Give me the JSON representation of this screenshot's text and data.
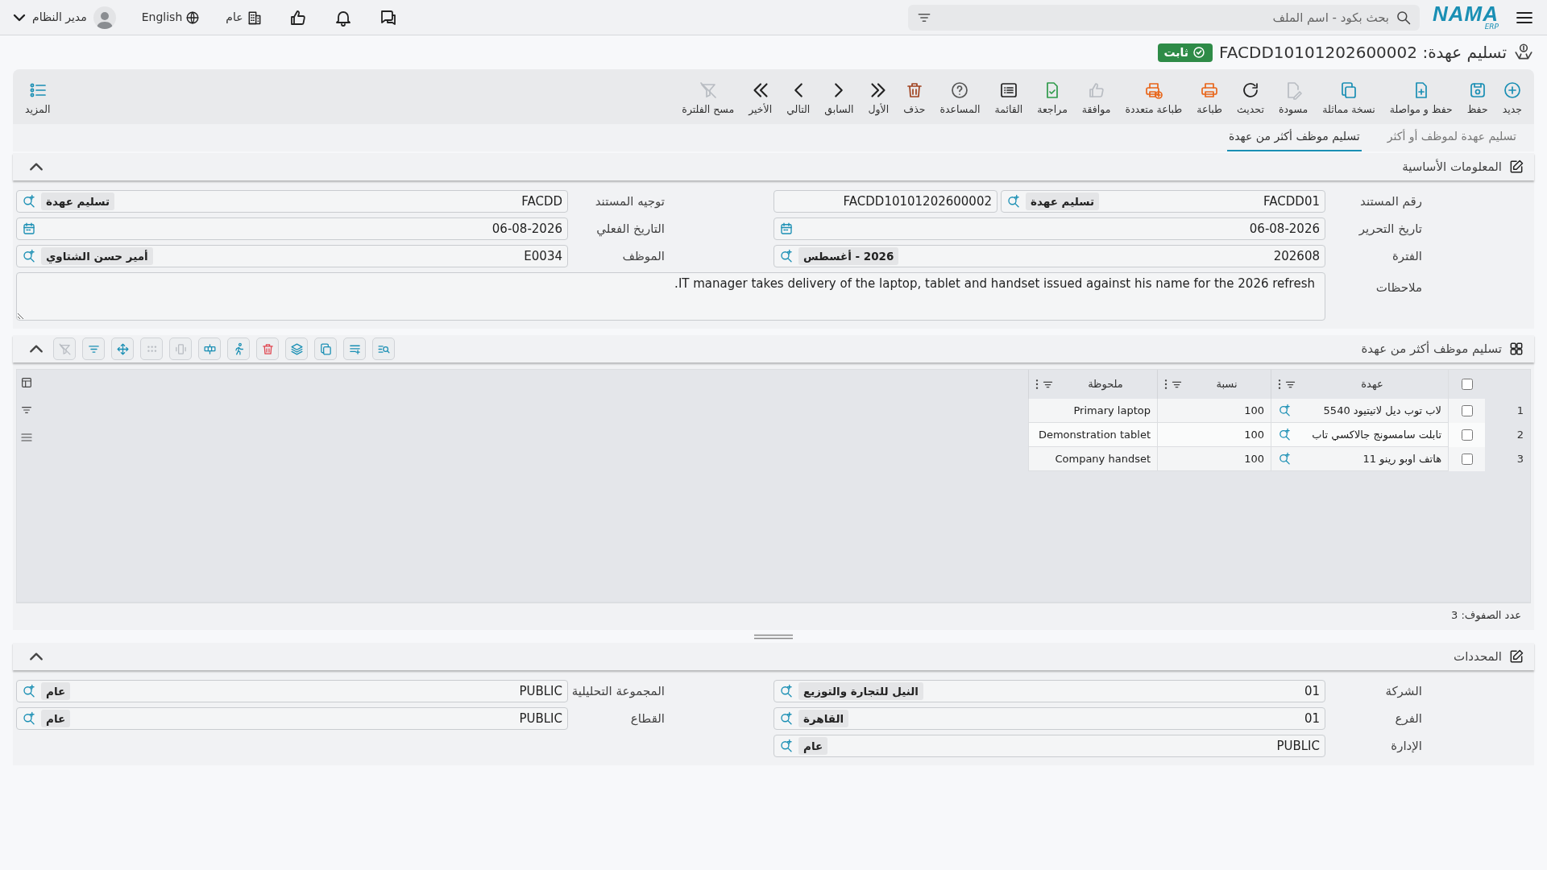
{
  "topbar": {
    "logo": "NAMA",
    "logo_sub": "ERP",
    "search_placeholder": "بحث بكود - اسم الملف",
    "scope": "عام",
    "language": "English",
    "user": "مدير النظام"
  },
  "header": {
    "title": "تسليم عهدة: FACDD10101202600002",
    "status": "ثابت"
  },
  "toolbar": [
    {
      "kind": "new",
      "label": "جديد",
      "disabled": false
    },
    {
      "kind": "save",
      "label": "حفظ",
      "disabled": false
    },
    {
      "kind": "save_continue",
      "label": "حفظ و مواصلة",
      "disabled": false
    },
    {
      "kind": "duplicate",
      "label": "نسخة مماثلة",
      "disabled": false
    },
    {
      "kind": "draft",
      "label": "مسودة",
      "disabled": true
    },
    {
      "kind": "refresh",
      "label": "تحديث",
      "disabled": false
    },
    {
      "kind": "print",
      "label": "طباعة",
      "disabled": false
    },
    {
      "kind": "multi_print",
      "label": "طباعة متعددة",
      "disabled": false
    },
    {
      "kind": "approve",
      "label": "موافقة",
      "disabled": true
    },
    {
      "kind": "review",
      "label": "مراجعة",
      "disabled": false
    },
    {
      "kind": "list",
      "label": "القائمة",
      "disabled": false
    },
    {
      "kind": "help",
      "label": "المساعدة",
      "disabled": false
    },
    {
      "kind": "delete",
      "label": "حذف",
      "disabled": false
    },
    {
      "kind": "first",
      "label": "الأول",
      "disabled": false
    },
    {
      "kind": "prev",
      "label": "السابق",
      "disabled": false
    },
    {
      "kind": "next",
      "label": "التالي",
      "disabled": false
    },
    {
      "kind": "last",
      "label": "الأخير",
      "disabled": false
    },
    {
      "kind": "clear_filter",
      "label": "مسح الفلترة",
      "disabled": true
    }
  ],
  "more": {
    "label": "المزيد"
  },
  "tabs": [
    {
      "label": "تسليم عهدة لموظف أو أكثر",
      "selected": false
    },
    {
      "label": "تسليم موظف أكثر من عهدة",
      "selected": true
    }
  ],
  "basic_info": {
    "title": "المعلومات الأساسية",
    "expanded": true,
    "fields": [
      {
        "kind": "lookup",
        "label": "رقم المستند",
        "value": "FACDD01",
        "name": "تسليم عهدة",
        "extra": "FACDD10101202600002"
      },
      {
        "kind": "lookup",
        "label": "توجيه المستند",
        "value": "FACDD",
        "name": "تسليم عهدة"
      },
      {
        "kind": "date",
        "label": "تاريخ التحرير",
        "value": "06-08-2026"
      },
      {
        "kind": "date",
        "label": "التاريخ الفعلي",
        "value": "06-08-2026"
      },
      {
        "kind": "lookup",
        "label": "الفترة",
        "value": "202608",
        "name": "2026 - أغسطس"
      },
      {
        "kind": "lookup",
        "label": "الموظف",
        "value": "E0034",
        "name": "أمير حسن الشتاوي"
      },
      {
        "kind": "notes",
        "label": "ملاحظات",
        "value": "IT manager takes delivery of the laptop, tablet and handset issued against his name for the 2026 refresh."
      }
    ]
  },
  "items_section": {
    "title": "تسليم موظف أكثر من عهدة",
    "expanded": true,
    "tools": [
      {
        "kind": "search_list",
        "disabled": false
      },
      {
        "kind": "list_add",
        "disabled": false
      },
      {
        "kind": "copy",
        "disabled": false
      },
      {
        "kind": "layers",
        "disabled": false
      },
      {
        "kind": "delete",
        "disabled": false
      },
      {
        "kind": "run",
        "disabled": false
      },
      {
        "kind": "table_row",
        "disabled": false
      },
      {
        "kind": "column",
        "disabled": true
      },
      {
        "kind": "dots",
        "disabled": true
      },
      {
        "kind": "move",
        "disabled": false
      },
      {
        "kind": "filter",
        "disabled": false
      },
      {
        "kind": "clear_filter",
        "disabled": true
      }
    ],
    "table": {
      "all_checked": false,
      "columns": [
        "عهدة",
        "نسبة",
        "ملحوظة"
      ],
      "rows": [
        {
          "number": "1",
          "checked": false,
          "item": "لاب توب ديل لاتيتيود 5540",
          "ratio": "100",
          "note": "Primary laptop"
        },
        {
          "number": "2",
          "checked": false,
          "item": "تابلت سامسونج جالاكسي تاب",
          "ratio": "100",
          "note": "Demonstration tablet"
        },
        {
          "number": "3",
          "checked": false,
          "item": "هاتف اوبو رينو 11",
          "ratio": "100",
          "note": "Company handset"
        }
      ],
      "row_count": "عدد الصفوف: 3"
    }
  },
  "determinants": {
    "title": "المحددات",
    "expanded": true,
    "fields": [
      {
        "kind": "lookup",
        "label": "الشركة",
        "value": "01",
        "name": "النيل للتجارة والتوزيع"
      },
      {
        "kind": "lookup",
        "label": "المجموعة التحليلية",
        "value": "PUBLIC",
        "name": "عام"
      },
      {
        "kind": "lookup",
        "label": "الفرع",
        "value": "01",
        "name": "القاهرة"
      },
      {
        "kind": "lookup",
        "label": "القطاع",
        "value": "PUBLIC",
        "name": "عام"
      },
      {
        "kind": "lookup",
        "label": "الإدارة",
        "value": "PUBLIC",
        "name": "عام"
      }
    ]
  }
}
